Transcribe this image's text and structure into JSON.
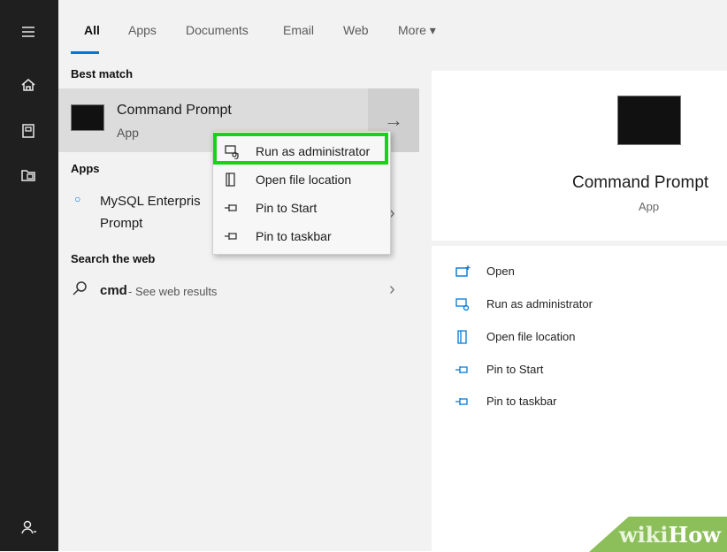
{
  "tabs": [
    "All",
    "Apps",
    "Documents",
    "Email",
    "Web",
    "More ▾"
  ],
  "sections": {
    "best_match": "Best match",
    "apps": "Apps",
    "search_web": "Search the web"
  },
  "best_match": {
    "title": "Command Prompt",
    "subtitle": "App"
  },
  "apps_item": {
    "line1": "MySQL Enterpris",
    "line2": "Prompt"
  },
  "web_search": {
    "query": "cmd",
    "suffix": " - See web results"
  },
  "context_menu": [
    "Run as administrator",
    "Open file location",
    "Pin to Start",
    "Pin to taskbar"
  ],
  "preview": {
    "title": "Command Prompt",
    "subtitle": "App"
  },
  "actions": [
    "Open",
    "Run as administrator",
    "Open file location",
    "Pin to Start",
    "Pin to taskbar"
  ],
  "watermark": {
    "part1": "wiki",
    "part2": "How"
  },
  "icons": [
    "hamburger-icon",
    "home-icon",
    "document-icon",
    "folder-icon",
    "user-icon",
    "search-icon"
  ],
  "colors": {
    "accent": "#0078d7",
    "highlight": "#17d317",
    "rail": "#1f1f1f"
  }
}
